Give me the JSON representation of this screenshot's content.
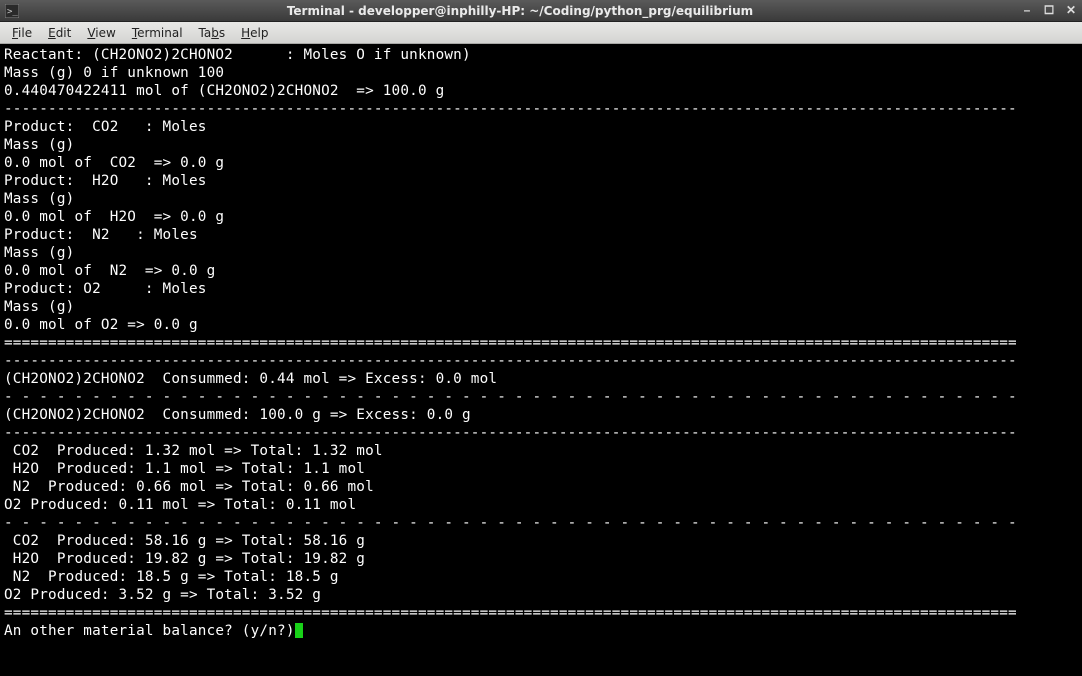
{
  "window": {
    "title": "Terminal - developper@inphilly-HP: ~/Coding/python_prg/equilibrium"
  },
  "menu": {
    "file": "File",
    "edit": "Edit",
    "view": "View",
    "terminal": "Terminal",
    "tabs": "Tabs",
    "help": "Help"
  },
  "terminal": {
    "lines": [
      "Reactant: (CH2ONO2)2CHONO2      : Moles O if unknown)",
      "Mass (g) 0 if unknown 100",
      "0.440470422411 mol of (CH2ONO2)2CHONO2  => 100.0 g",
      "-------------------------------------------------------------------------------------------------------------------",
      "Product:  CO2   : Moles",
      "Mass (g)",
      "0.0 mol of  CO2  => 0.0 g",
      "Product:  H2O   : Moles",
      "Mass (g)",
      "0.0 mol of  H2O  => 0.0 g",
      "Product:  N2   : Moles",
      "Mass (g)",
      "0.0 mol of  N2  => 0.0 g",
      "Product: O2     : Moles",
      "Mass (g)",
      "0.0 mol of O2 => 0.0 g",
      "===================================================================================================================",
      "-------------------------------------------------------------------------------------------------------------------",
      "(CH2ONO2)2CHONO2  Consummed: 0.44 mol => Excess: 0.0 mol",
      "- - - - - - - - - - - - - - - - - - - - - - - - - - - - - - - - - - - - - - - - - - - - - - - - - - - - - - - - - -",
      "(CH2ONO2)2CHONO2  Consummed: 100.0 g => Excess: 0.0 g",
      "-------------------------------------------------------------------------------------------------------------------",
      " CO2  Produced: 1.32 mol => Total: 1.32 mol",
      " H2O  Produced: 1.1 mol => Total: 1.1 mol",
      " N2  Produced: 0.66 mol => Total: 0.66 mol",
      "O2 Produced: 0.11 mol => Total: 0.11 mol",
      "- - - - - - - - - - - - - - - - - - - - - - - - - - - - - - - - - - - - - - - - - - - - - - - - - - - - - - - - - -",
      " CO2  Produced: 58.16 g => Total: 58.16 g",
      " H2O  Produced: 19.82 g => Total: 19.82 g",
      " N2  Produced: 18.5 g => Total: 18.5 g",
      "O2 Produced: 3.52 g => Total: 3.52 g",
      "==================================================================================================================="
    ],
    "prompt": "An other material balance? (y/n?)"
  }
}
